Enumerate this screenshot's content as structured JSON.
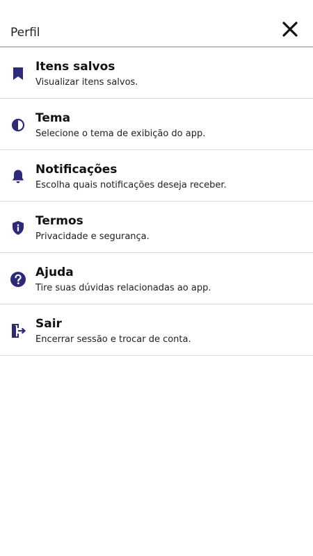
{
  "header": {
    "title": "Perfil",
    "close_icon": "close-icon"
  },
  "accent_color": "#2e2a7a",
  "menu": {
    "items": [
      {
        "icon": "bookmark-icon",
        "title": "Itens salvos",
        "subtitle": "Visualizar itens salvos."
      },
      {
        "icon": "theme-icon",
        "title": "Tema",
        "subtitle": "Selecione o tema de exibição do app."
      },
      {
        "icon": "bell-icon",
        "title": "Notificações",
        "subtitle": "Escolha quais notificações deseja receber."
      },
      {
        "icon": "shield-info-icon",
        "title": "Termos",
        "subtitle": "Privacidade e segurança."
      },
      {
        "icon": "help-icon",
        "title": "Ajuda",
        "subtitle": "Tire suas dúvidas relacionadas ao app."
      },
      {
        "icon": "logout-icon",
        "title": "Sair",
        "subtitle": "Encerrar sessão e trocar de conta."
      }
    ]
  }
}
